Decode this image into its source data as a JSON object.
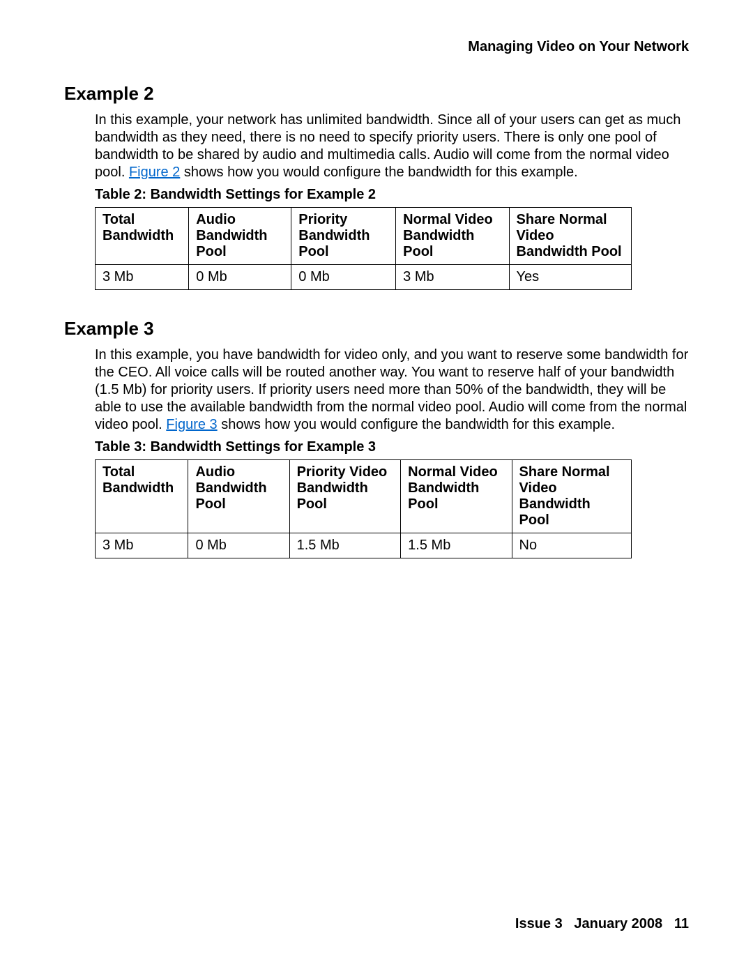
{
  "header": "Managing Video on Your Network",
  "example2": {
    "heading": "Example 2",
    "para_before": "In this example, your network has unlimited bandwidth. Since all of your users can get as much bandwidth as they need, there is no need to specify priority users. There is only one pool of bandwidth to be shared by audio and multimedia calls. Audio will come from the normal video pool. ",
    "link_text": "Figure 2",
    "para_after": " shows how you would configure the bandwidth for this example.",
    "caption": "Table 2: Bandwidth Settings for Example 2",
    "headers": [
      "Total Bandwidth",
      "Audio Bandwidth Pool",
      "Priority Bandwidth Pool",
      "Normal Video Bandwidth Pool",
      "Share Normal Video Bandwidth Pool"
    ],
    "row": [
      "3 Mb",
      "0 Mb",
      "0 Mb",
      "3 Mb",
      "Yes"
    ]
  },
  "example3": {
    "heading": "Example 3",
    "para_before": "In this example, you have bandwidth for video only, and you want to reserve some bandwidth for the CEO. All voice calls will be routed another way. You want to reserve half of your bandwidth (1.5 Mb) for priority users. If priority users need more than 50% of the bandwidth, they will be able to use the available bandwidth from the normal video pool. Audio will come from the normal video pool. ",
    "link_text": "Figure 3",
    "para_after": " shows how you would configure the bandwidth for this example.",
    "caption": "Table 3: Bandwidth Settings for Example 3",
    "headers": [
      "Total Bandwidth",
      "Audio Bandwidth Pool",
      "Priority Video Bandwidth Pool",
      "Normal Video Bandwidth Pool",
      "Share Normal Video Bandwidth Pool"
    ],
    "row": [
      "3 Mb",
      "0 Mb",
      "1.5 Mb",
      "1.5 Mb",
      "No"
    ]
  },
  "footer": {
    "issue": "Issue 3",
    "date": "January 2008",
    "page": "11"
  }
}
